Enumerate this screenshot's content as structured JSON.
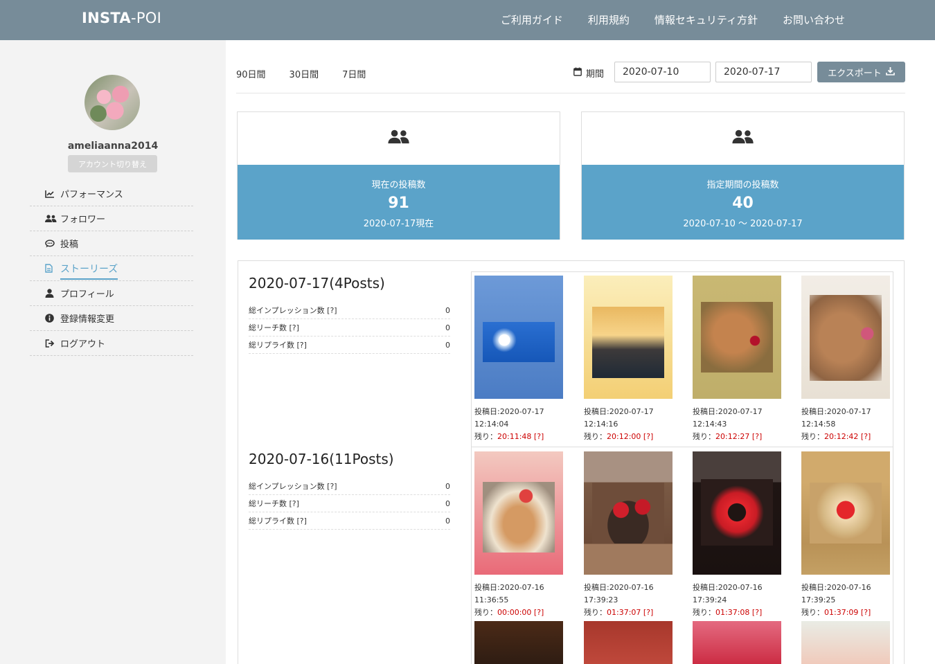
{
  "header": {
    "logo_a": "INSTA",
    "logo_b": "-POI",
    "nav": [
      "ご利用ガイド",
      "利用規約",
      "情報セキュリティ方針",
      "お問い合わせ"
    ]
  },
  "sidebar": {
    "username": "ameliaanna2014",
    "switch_label": "アカウント切り替え",
    "items": [
      {
        "label": "パフォーマンス",
        "icon": "chart-line-icon"
      },
      {
        "label": "フォロワー",
        "icon": "users-icon"
      },
      {
        "label": "投稿",
        "icon": "comment-icon"
      },
      {
        "label": "ストーリーズ",
        "icon": "file-icon"
      },
      {
        "label": "プロフィール",
        "icon": "user-icon"
      },
      {
        "label": "登録情報変更",
        "icon": "info-circle-icon"
      },
      {
        "label": "ログアウト",
        "icon": "sign-out-icon"
      }
    ],
    "active_index": 3
  },
  "toolbar": {
    "periods": [
      "90日間",
      "30日間",
      "7日間"
    ],
    "period_label": "期間",
    "date_from": "2020-07-10",
    "date_to": "2020-07-17",
    "export_label": "エクスポート"
  },
  "stats": [
    {
      "title": "現在の投稿数",
      "number": "91",
      "sub": "2020-07-17現在"
    },
    {
      "title": "指定期間の投稿数",
      "number": "40",
      "sub": "2020-07-10 ～ 2020-07-17"
    }
  ],
  "days": [
    {
      "heading": "2020-07-17(4Posts)",
      "metrics": [
        {
          "label": "総インプレッション数 [?]",
          "value": "0"
        },
        {
          "label": "総リーチ数 [?]",
          "value": "0"
        },
        {
          "label": "総リプライ数 [?]",
          "value": "0"
        }
      ]
    },
    {
      "heading": "2020-07-16(11Posts)",
      "metrics": [
        {
          "label": "総インプレッション数 [?]",
          "value": "0"
        },
        {
          "label": "総リーチ数 [?]",
          "value": "0"
        },
        {
          "label": "総リプライ数 [?]",
          "value": "0"
        }
      ]
    }
  ],
  "remain_prefix": "残り：",
  "posts": [
    {
      "date": "投稿日:2020-07-17",
      "time": "12:14:04",
      "remain": "20:11:48 [?]"
    },
    {
      "date": "投稿日:2020-07-17",
      "time": "12:14:16",
      "remain": "20:12:00 [?]"
    },
    {
      "date": "投稿日:2020-07-17",
      "time": "12:14:43",
      "remain": "20:12:27 [?]"
    },
    {
      "date": "投稿日:2020-07-17",
      "time": "12:14:58",
      "remain": "20:12:42 [?]"
    },
    {
      "date": "投稿日:2020-07-16",
      "time": "11:36:55",
      "remain": "00:00:00 [?]"
    },
    {
      "date": "投稿日:2020-07-16",
      "time": "17:39:23",
      "remain": "01:37:07 [?]"
    },
    {
      "date": "投稿日:2020-07-16",
      "time": "17:39:24",
      "remain": "01:37:08 [?]"
    },
    {
      "date": "投稿日:2020-07-16",
      "time": "17:39:25",
      "remain": "01:37:09 [?]"
    }
  ],
  "colors": {
    "header": "#778c99",
    "accent": "#5ba3c9",
    "remain": "#cc0000"
  }
}
